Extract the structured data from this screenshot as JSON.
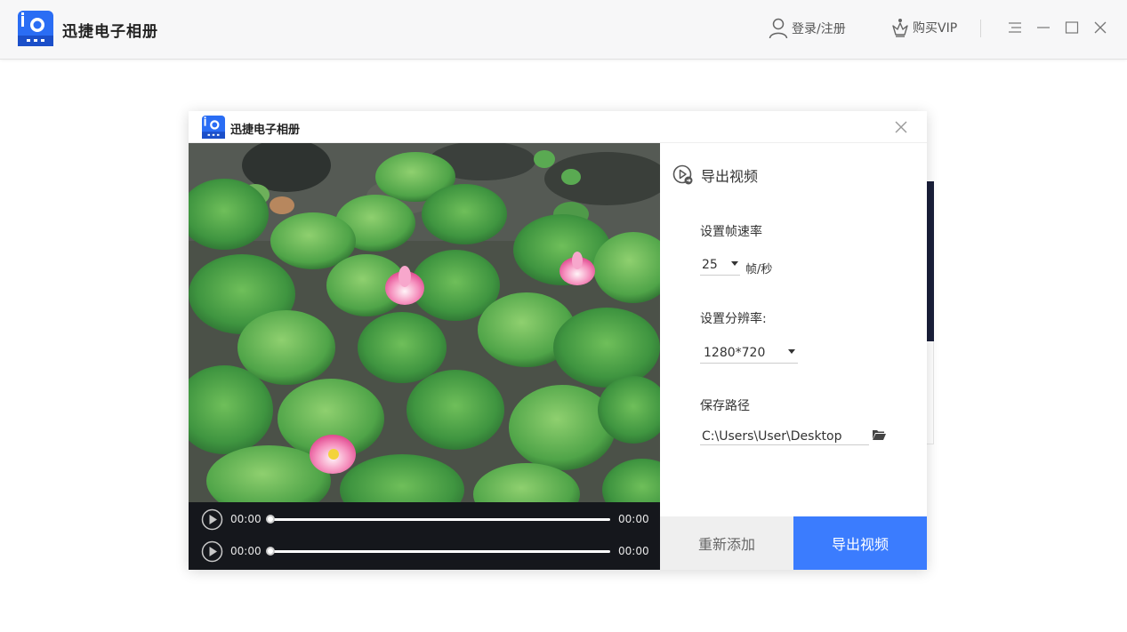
{
  "app": {
    "title": "迅捷电子相册",
    "brand_color": "#2a6df4"
  },
  "header": {
    "login_label": "登录/注册",
    "vip_label": "购买VIP",
    "icons": [
      "user-icon",
      "crown-icon",
      "menu-icon",
      "minimize-icon",
      "maximize-icon",
      "close-icon"
    ]
  },
  "dialog": {
    "title": "迅捷电子相册",
    "panel": {
      "heading": "导出视频",
      "fps_label": "设置帧速率",
      "fps_value": "25",
      "fps_unit": "帧/秒",
      "resolution_label": "设置分辨率:",
      "resolution_value": "1280*720",
      "path_label": "保存路径",
      "path_value": "C:\\Users\\User\\Desktop"
    },
    "player": {
      "rows": [
        {
          "current": "00:00",
          "total": "00:00",
          "progress": 0
        },
        {
          "current": "00:00",
          "total": "00:00",
          "progress": 0
        }
      ]
    },
    "buttons": {
      "readd": "重新添加",
      "export": "导出视频"
    },
    "colors": {
      "export_button": "#3b7cfe",
      "readd_button": "#efefef",
      "player_bg": "#15171c"
    }
  }
}
